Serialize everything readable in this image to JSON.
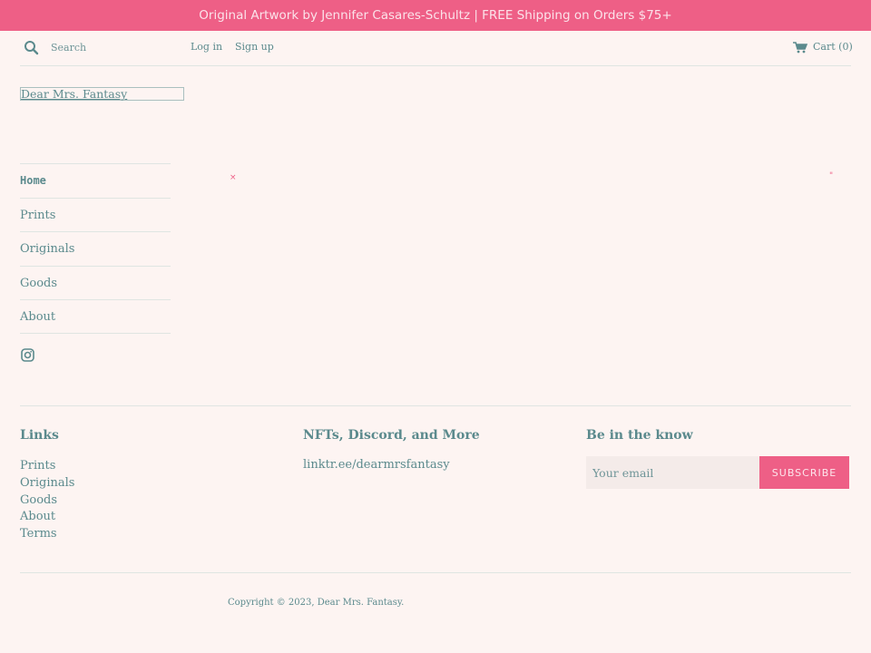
{
  "announcement": "Original Artwork by Jennifer Casares-Schultz | FREE Shipping on Orders $75+",
  "header": {
    "search_placeholder": "Search",
    "login_label": "Log in",
    "signup_label": "Sign up",
    "cart_label": "Cart (0)"
  },
  "logo_text": "Dear Mrs. Fantasy",
  "nav": {
    "items": [
      {
        "label": "Home"
      },
      {
        "label": "Prints"
      },
      {
        "label": "Originals"
      },
      {
        "label": "Goods"
      },
      {
        "label": "About"
      }
    ]
  },
  "marks": {
    "left": "×",
    "right": "\""
  },
  "footer": {
    "links_heading": "Links",
    "links": [
      "Prints",
      "Originals",
      "Goods",
      "About",
      "Terms"
    ],
    "more_heading": "NFTs, Discord, and More",
    "more_text": "linktr.ee/dearmrsfantasy",
    "newsletter_heading": "Be in the know",
    "email_placeholder": "Your email",
    "subscribe_label": "SUBSCRIBE",
    "copyright": "Copyright © 2023, Dear Mrs. Fantasy."
  },
  "colors": {
    "accent": "#ee5f86",
    "text": "#5b8a8d",
    "background": "#fdf4f2"
  }
}
